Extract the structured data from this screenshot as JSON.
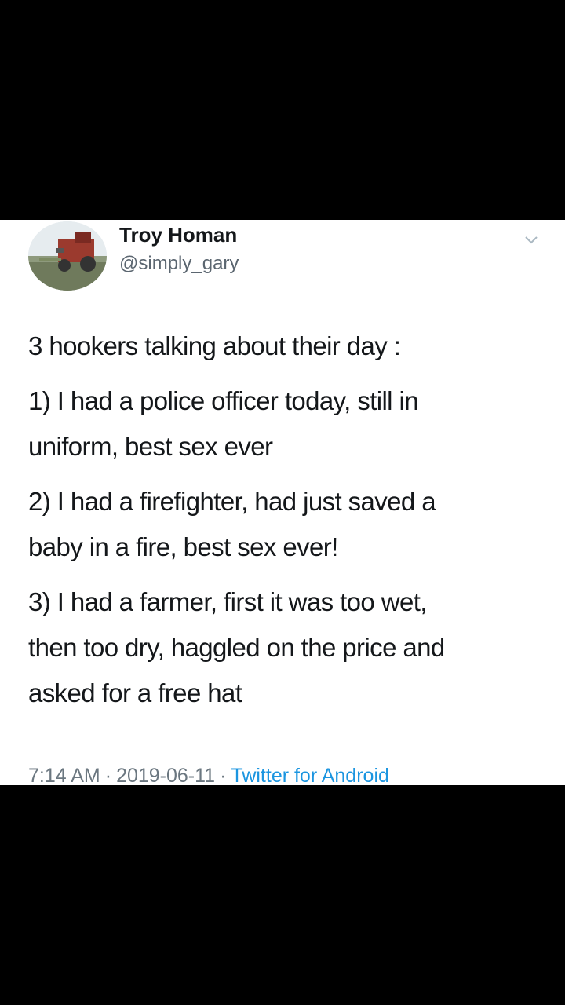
{
  "tweet": {
    "author_name": "Troy Homan",
    "handle": "@simply_gary",
    "lines": [
      "3 hookers talking about their day :",
      "1) I had a police officer today, still in",
      "uniform, best sex ever",
      "2) I had a firefighter, had just saved a",
      "baby in a fire, best sex ever!",
      "3) I had a farmer, first it was too wet,",
      "then too dry, haggled on the price and",
      "asked for a free hat"
    ],
    "time": "7:14 AM",
    "separator": "·",
    "date": "2019-06-11",
    "source": "Twitter for Android"
  },
  "icons": {
    "avatar": "avatar-tractor-photo",
    "menu": "chevron-down-icon"
  },
  "colors": {
    "background": "#000000",
    "card": "#ffffff",
    "text": "#14171a",
    "secondary_text": "#5b6670",
    "source_link": "#1b95e0"
  }
}
